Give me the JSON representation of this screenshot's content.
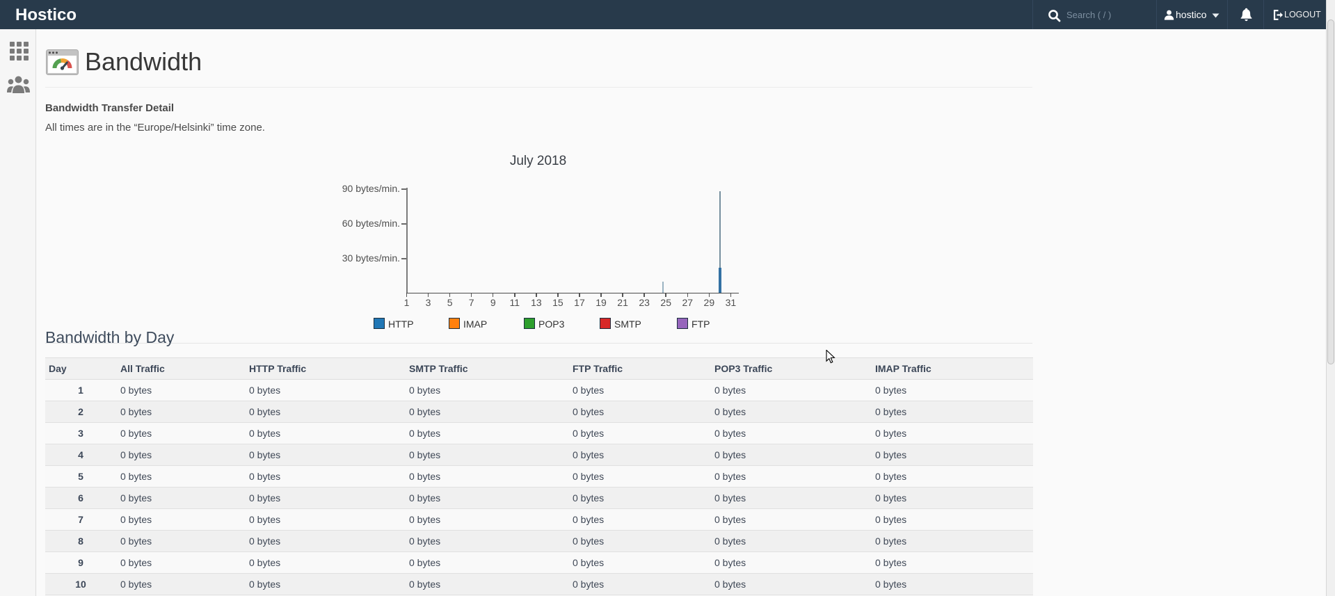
{
  "header": {
    "brand": "Hostico",
    "search_placeholder": "Search ( / )",
    "user": "hostico",
    "logout_label": "LOGOUT"
  },
  "page": {
    "title": "Bandwidth",
    "section_heading": "Bandwidth Transfer Detail",
    "timezone_note": "All times are in the “Europe/Helsinki” time zone.",
    "table_heading": "Bandwidth by Day"
  },
  "chart_data": {
    "type": "line",
    "title": "July 2018",
    "ylim": [
      0,
      90
    ],
    "xlim": [
      1,
      31.8
    ],
    "y_ticks": [
      {
        "value": 90,
        "label": "90 bytes/min."
      },
      {
        "value": 60,
        "label": "60 bytes/min."
      },
      {
        "value": 30,
        "label": "30 bytes/min."
      }
    ],
    "x_tick_labels": [
      "1",
      "3",
      "5",
      "7",
      "9",
      "11",
      "13",
      "15",
      "17",
      "19",
      "21",
      "23",
      "25",
      "27",
      "29",
      "31"
    ],
    "legend": [
      {
        "name": "HTTP",
        "color": "#2177b5"
      },
      {
        "name": "IMAP",
        "color": "#ff800e"
      },
      {
        "name": "POP3",
        "color": "#2d9f2d"
      },
      {
        "name": "SMTP",
        "color": "#d72828"
      },
      {
        "name": "FTP",
        "color": "#9665bc"
      }
    ],
    "spikes": [
      {
        "series": "HTTP",
        "day": 24.75,
        "value": 10,
        "color": "#9ab3c2",
        "thickness": 2
      },
      {
        "series": "HTTP",
        "day": 30,
        "value": 88,
        "color": "#768f9e",
        "thickness": 2
      },
      {
        "series": "HTTP",
        "day": 30,
        "value": 22,
        "color": "#3371a3",
        "thickness": 4
      }
    ]
  },
  "table": {
    "columns": [
      "Day",
      "All Traffic",
      "HTTP Traffic",
      "SMTP Traffic",
      "FTP Traffic",
      "POP3 Traffic",
      "IMAP Traffic"
    ],
    "rows": [
      {
        "day": "1",
        "values": [
          "0 bytes",
          "0 bytes",
          "0 bytes",
          "0 bytes",
          "0 bytes",
          "0 bytes"
        ]
      },
      {
        "day": "2",
        "values": [
          "0 bytes",
          "0 bytes",
          "0 bytes",
          "0 bytes",
          "0 bytes",
          "0 bytes"
        ]
      },
      {
        "day": "3",
        "values": [
          "0 bytes",
          "0 bytes",
          "0 bytes",
          "0 bytes",
          "0 bytes",
          "0 bytes"
        ]
      },
      {
        "day": "4",
        "values": [
          "0 bytes",
          "0 bytes",
          "0 bytes",
          "0 bytes",
          "0 bytes",
          "0 bytes"
        ]
      },
      {
        "day": "5",
        "values": [
          "0 bytes",
          "0 bytes",
          "0 bytes",
          "0 bytes",
          "0 bytes",
          "0 bytes"
        ]
      },
      {
        "day": "6",
        "values": [
          "0 bytes",
          "0 bytes",
          "0 bytes",
          "0 bytes",
          "0 bytes",
          "0 bytes"
        ]
      },
      {
        "day": "7",
        "values": [
          "0 bytes",
          "0 bytes",
          "0 bytes",
          "0 bytes",
          "0 bytes",
          "0 bytes"
        ]
      },
      {
        "day": "8",
        "values": [
          "0 bytes",
          "0 bytes",
          "0 bytes",
          "0 bytes",
          "0 bytes",
          "0 bytes"
        ]
      },
      {
        "day": "9",
        "values": [
          "0 bytes",
          "0 bytes",
          "0 bytes",
          "0 bytes",
          "0 bytes",
          "0 bytes"
        ]
      },
      {
        "day": "10",
        "values": [
          "0 bytes",
          "0 bytes",
          "0 bytes",
          "0 bytes",
          "0 bytes",
          "0 bytes"
        ]
      }
    ]
  }
}
